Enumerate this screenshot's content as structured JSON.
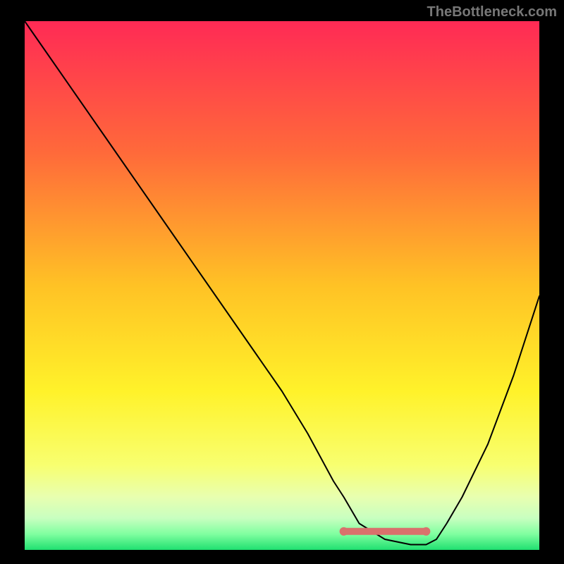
{
  "watermark": "TheBottleneck.com",
  "chart_data": {
    "type": "line",
    "title": "",
    "xlabel": "",
    "ylabel": "",
    "xlim": [
      0,
      100
    ],
    "ylim": [
      0,
      100
    ],
    "background_gradient": {
      "stops": [
        {
          "offset": 0.0,
          "color": "#ff2a55"
        },
        {
          "offset": 0.25,
          "color": "#ff6a3a"
        },
        {
          "offset": 0.5,
          "color": "#ffc225"
        },
        {
          "offset": 0.7,
          "color": "#fff22a"
        },
        {
          "offset": 0.84,
          "color": "#f8ff70"
        },
        {
          "offset": 0.9,
          "color": "#e8ffb0"
        },
        {
          "offset": 0.94,
          "color": "#c8ffc0"
        },
        {
          "offset": 0.97,
          "color": "#80ffa0"
        },
        {
          "offset": 1.0,
          "color": "#20e070"
        }
      ]
    },
    "series": [
      {
        "name": "bottleneck-curve",
        "color": "#000000",
        "width": 2,
        "x": [
          0,
          5,
          10,
          15,
          20,
          25,
          30,
          35,
          40,
          45,
          50,
          55,
          60,
          62,
          65,
          70,
          75,
          78,
          80,
          82,
          85,
          90,
          95,
          100
        ],
        "values": [
          100,
          93,
          86,
          79,
          72,
          65,
          58,
          51,
          44,
          37,
          30,
          22,
          13,
          10,
          5,
          2,
          1,
          1,
          2,
          5,
          10,
          20,
          33,
          48
        ]
      }
    ],
    "markers": [
      {
        "name": "flat-band-left",
        "x": 62,
        "y": 3.5,
        "r": 6,
        "color": "#d9716c"
      },
      {
        "name": "flat-band-right",
        "x": 78,
        "y": 3.5,
        "r": 6,
        "color": "#d9716c"
      }
    ],
    "flat_band": {
      "x_start": 62,
      "x_end": 78,
      "y": 3.5,
      "color": "#d9716c",
      "width": 10
    }
  }
}
